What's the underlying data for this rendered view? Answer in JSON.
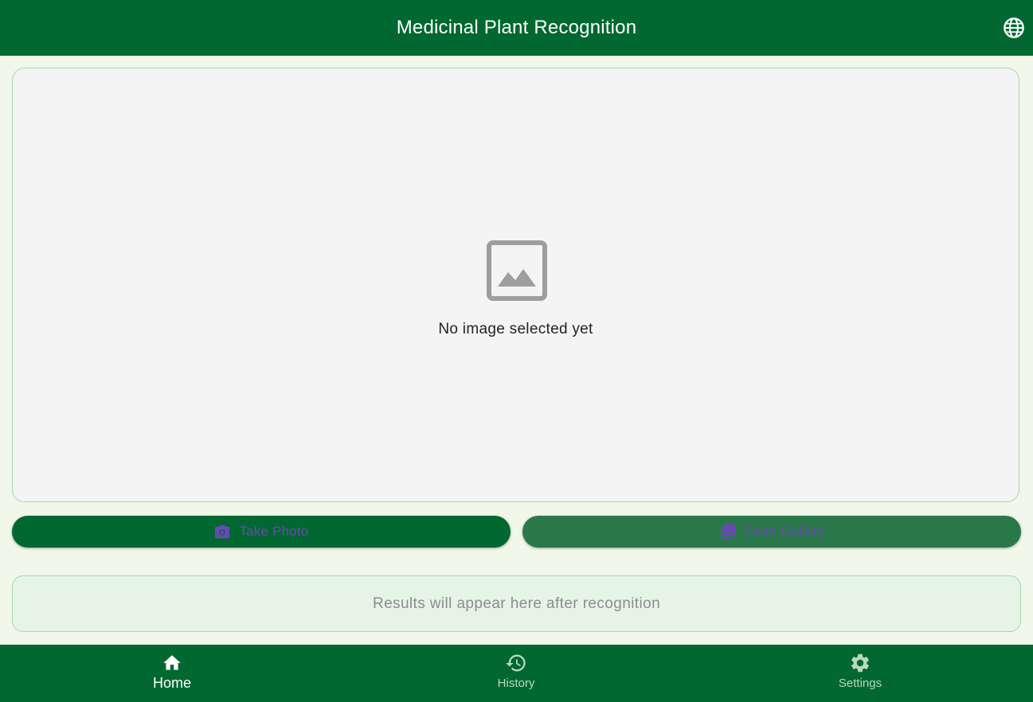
{
  "app_bar": {
    "title": "Medicinal Plant Recognition",
    "language_icon": "globe-icon"
  },
  "preview": {
    "icon": "image-placeholder-icon",
    "message": "No image selected yet"
  },
  "actions": {
    "take_photo": {
      "label": "Take Photo",
      "icon": "camera-icon"
    },
    "from_gallery": {
      "label": "From Gallery",
      "icon": "photo-library-icon"
    }
  },
  "results": {
    "placeholder": "Results will appear here after recognition"
  },
  "bottom_nav": {
    "items": [
      {
        "label": "Home",
        "icon": "home-icon",
        "active": true
      },
      {
        "label": "History",
        "icon": "history-icon",
        "active": false
      },
      {
        "label": "Settings",
        "icon": "gear-icon",
        "active": false
      }
    ]
  },
  "colors": {
    "primary": "#006830",
    "secondary_button": "#2a7849",
    "background": "#f1f7e9",
    "button_text": "#6a47b8",
    "card_border": "#a6d8ae"
  }
}
